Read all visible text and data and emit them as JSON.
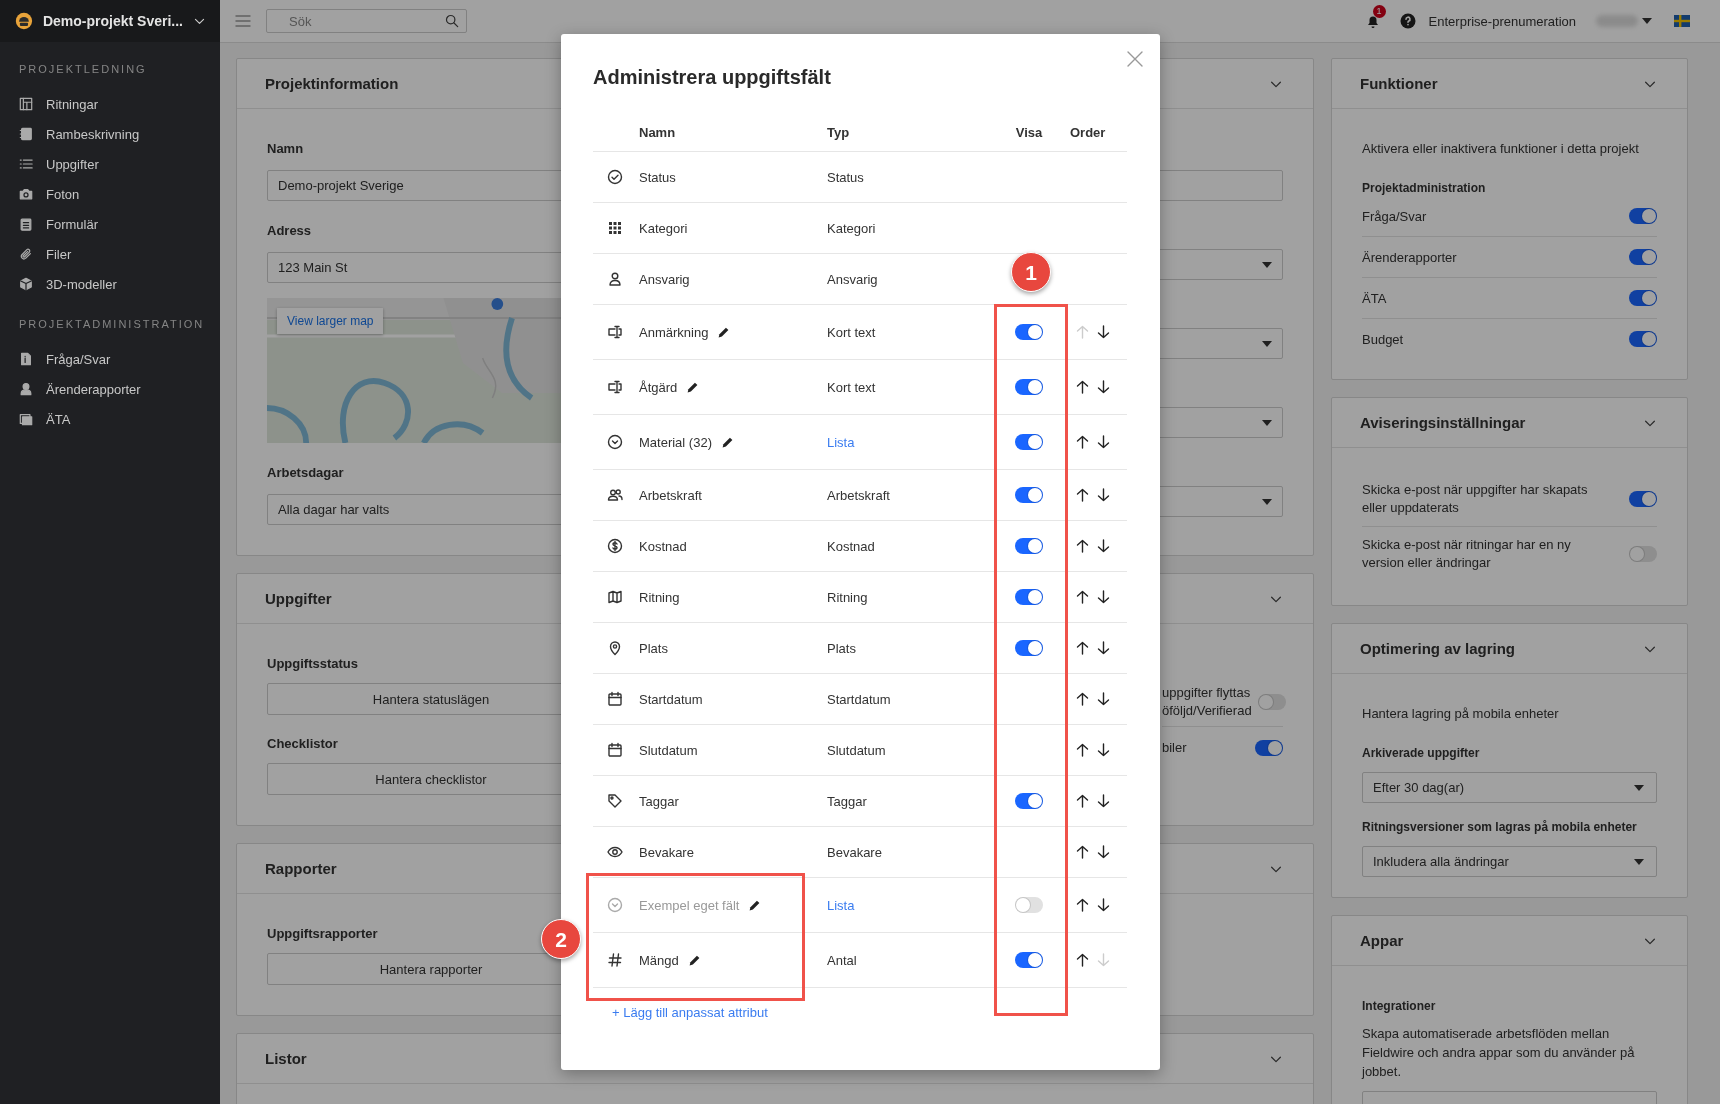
{
  "sidebar": {
    "project": "Demo-projekt Sveri...",
    "sections": [
      {
        "title": "PROJEKTLEDNING",
        "items": [
          {
            "kind": "drawings",
            "label": "Ritningar"
          },
          {
            "kind": "spec",
            "label": "Rambeskrivning"
          },
          {
            "kind": "tasks",
            "label": "Uppgifter"
          },
          {
            "kind": "photos",
            "label": "Foton"
          },
          {
            "kind": "forms",
            "label": "Formulär"
          },
          {
            "kind": "files",
            "label": "Filer"
          },
          {
            "kind": "models",
            "label": "3D-modeller"
          }
        ]
      },
      {
        "title": "PROJEKTADMINISTRATION",
        "items": [
          {
            "kind": "qa",
            "label": "Fråga/Svar"
          },
          {
            "kind": "reports",
            "label": "Ärenderapporter"
          },
          {
            "kind": "ata",
            "label": "ÄTA"
          }
        ]
      }
    ]
  },
  "topbar": {
    "search": {
      "placeholder": "Sök"
    },
    "notification_count": "1",
    "plan": "Enterprise-prenumeration"
  },
  "left_cards": [
    {
      "kind": "project_info",
      "title": "Projektinformation",
      "name_label": "Namn",
      "name_value": "Demo-projekt Sverige",
      "address_label": "Adress",
      "address_value": "123 Main St",
      "map_link": "View larger map",
      "workdays_label": "Arbetsdagar",
      "workdays_value": "Alla dagar har valts",
      "side_fields": [
        {
          "kind": "input"
        },
        {
          "kind": "select"
        },
        {
          "kind": "select"
        },
        {
          "kind": "select"
        },
        {
          "kind": "select"
        }
      ]
    },
    {
      "kind": "sections",
      "title": "Uppgifter",
      "sections": [
        {
          "label": "Uppgiftsstatus",
          "button": "Hantera statuslägen"
        },
        {
          "label": "Checklistor",
          "button": "Hantera checklistor"
        }
      ],
      "side_toggles": [
        {
          "label": "uppgifter flyttas öföljd/Verifierad",
          "on": false
        },
        {
          "label": "biler",
          "on": true
        }
      ]
    },
    {
      "kind": "sections",
      "title": "Rapporter",
      "sections": [
        {
          "label": "Uppgiftsrapporter",
          "button": "Hantera rapporter"
        }
      ]
    },
    {
      "kind": "sections",
      "title": "Listor"
    }
  ],
  "right_cards": [
    {
      "title": "Funktioner",
      "items": [
        {
          "kind": "text",
          "text": "Aktivera eller inaktivera funktioner i detta projekt"
        },
        {
          "kind": "heading",
          "text": "Projektadministration"
        },
        {
          "kind": "toggle",
          "text": "Fråga/Svar",
          "on": true
        },
        {
          "kind": "toggle",
          "text": "Ärenderapporter",
          "on": true
        },
        {
          "kind": "toggle",
          "text": "ÄTA",
          "on": true
        },
        {
          "kind": "toggle",
          "text": "Budget",
          "on": true
        }
      ]
    },
    {
      "title": "Aviseringsinställningar",
      "items": [
        {
          "kind": "toggle",
          "text": "Skicka e-post när uppgifter har skapats eller uppdaterats",
          "on": true
        },
        {
          "kind": "toggle",
          "text": "Skicka e-post när ritningar har en ny version eller ändringar",
          "on": false
        }
      ]
    },
    {
      "title": "Optimering av lagring",
      "items": [
        {
          "kind": "text",
          "text": "Hantera lagring på mobila enheter"
        },
        {
          "kind": "heading",
          "text": "Arkiverade uppgifter"
        },
        {
          "kind": "select",
          "text": "Efter 30 dag(ar)"
        },
        {
          "kind": "heading",
          "text": "Ritningsversioner som lagras på mobila enheter"
        },
        {
          "kind": "select",
          "text": "Inkludera alla ändringar"
        }
      ]
    },
    {
      "title": "Appar",
      "items": [
        {
          "kind": "heading",
          "text": "Integrationer"
        },
        {
          "kind": "text",
          "text": "Skapa automatiserade arbetsflöden mellan Fieldwire och andra appar som du använder på jobbet."
        },
        {
          "kind": "button_stub"
        }
      ]
    }
  ],
  "modal": {
    "title": "Administrera uppgiftsfält",
    "columns": [
      "Namn",
      "Typ",
      "Visa",
      "Order"
    ],
    "rows": [
      {
        "kind": "status",
        "name": "Status",
        "editable": false,
        "muted": false,
        "type": "Status",
        "type_link": false
      },
      {
        "kind": "category",
        "name": "Kategori",
        "editable": false,
        "muted": false,
        "type": "Kategori",
        "type_link": false
      },
      {
        "kind": "person",
        "name": "Ansvarig",
        "editable": false,
        "muted": false,
        "type": "Ansvarig",
        "type_link": false
      },
      {
        "kind": "short_text",
        "name": "Anmärkning",
        "editable": true,
        "muted": false,
        "type": "Kort text",
        "type_link": false,
        "shown": true,
        "order": {
          "up_enabled": false,
          "down_enabled": true
        }
      },
      {
        "kind": "short_text",
        "name": "Åtgärd",
        "editable": true,
        "muted": false,
        "type": "Kort text",
        "type_link": false,
        "shown": true,
        "order": {
          "up_enabled": true,
          "down_enabled": true
        }
      },
      {
        "kind": "list",
        "name": "Material (32)",
        "editable": true,
        "muted": false,
        "type": "Lista",
        "type_link": true,
        "shown": true,
        "order": {
          "up_enabled": true,
          "down_enabled": true
        }
      },
      {
        "kind": "people",
        "name": "Arbetskraft",
        "editable": false,
        "muted": false,
        "type": "Arbetskraft",
        "type_link": false,
        "shown": true,
        "order": {
          "up_enabled": true,
          "down_enabled": true
        }
      },
      {
        "kind": "money",
        "name": "Kostnad",
        "editable": false,
        "muted": false,
        "type": "Kostnad",
        "type_link": false,
        "shown": true,
        "order": {
          "up_enabled": true,
          "down_enabled": true
        }
      },
      {
        "kind": "map",
        "name": "Ritning",
        "editable": false,
        "muted": false,
        "type": "Ritning",
        "type_link": false,
        "shown": true,
        "order": {
          "up_enabled": true,
          "down_enabled": true
        }
      },
      {
        "kind": "pin",
        "name": "Plats",
        "editable": false,
        "muted": false,
        "type": "Plats",
        "type_link": false,
        "shown": true,
        "order": {
          "up_enabled": true,
          "down_enabled": true
        }
      },
      {
        "kind": "calendar",
        "name": "Startdatum",
        "editable": false,
        "muted": false,
        "type": "Startdatum",
        "type_link": false,
        "order": {
          "up_enabled": true,
          "down_enabled": true
        }
      },
      {
        "kind": "calendar",
        "name": "Slutdatum",
        "editable": false,
        "muted": false,
        "type": "Slutdatum",
        "type_link": false,
        "order": {
          "up_enabled": true,
          "down_enabled": true
        }
      },
      {
        "kind": "tag",
        "name": "Taggar",
        "editable": false,
        "muted": false,
        "type": "Taggar",
        "type_link": false,
        "shown": true,
        "order": {
          "up_enabled": true,
          "down_enabled": true
        }
      },
      {
        "kind": "eye",
        "name": "Bevakare",
        "editable": false,
        "muted": false,
        "type": "Bevakare",
        "type_link": false,
        "order": {
          "up_enabled": true,
          "down_enabled": true
        }
      },
      {
        "kind": "list",
        "name": "Exempel eget fält",
        "editable": true,
        "muted": true,
        "type": "Lista",
        "type_link": true,
        "shown": false,
        "order": {
          "up_enabled": true,
          "down_enabled": true
        }
      },
      {
        "kind": "number",
        "name": "Mängd",
        "editable": true,
        "muted": false,
        "type": "Antal",
        "type_link": false,
        "shown": true,
        "order": {
          "up_enabled": true,
          "down_enabled": false
        }
      }
    ],
    "add_link": "+ Lägg till anpassat attribut"
  },
  "annotations": [
    {
      "number": "1"
    },
    {
      "number": "2"
    }
  ]
}
